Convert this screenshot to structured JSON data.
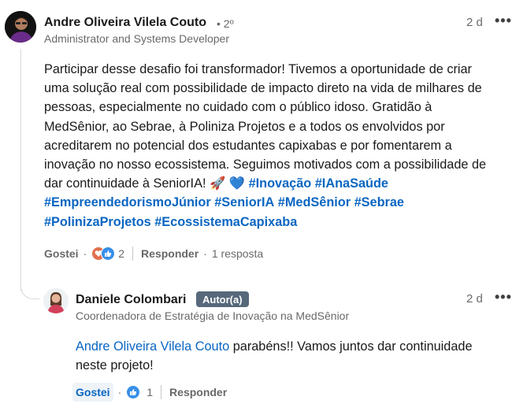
{
  "comment": {
    "author": "Andre Oliveira Vilela Couto",
    "degree": "• 2º",
    "headline": "Administrator and Systems Developer",
    "time": "2 d",
    "more": "•••",
    "text_lines": [
      "Participar desse desafio foi transformador! Tivemos a oportunidade de criar",
      "uma solução real com possibilidade de impacto direto na vida de milhares de",
      "pessoas, especialmente no cuidado com o público idoso. Gratidão à",
      "MedSênior, ao Sebrae, à Poliniza Projetos e a todos os envolvidos por",
      "acreditarem no potencial dos estudantes capixabas e por fomentarem a",
      "inovação no nosso ecossistema. Seguimos motivados com a possibilidade de"
    ],
    "last_line_text": "dar continuidade à SeniorIA! 🚀 💙 ",
    "hashtags": [
      "#Inovação",
      "#IAnaSaúde",
      "#EmpreendedorismoJúnior",
      "#SeniorIA",
      "#MedSênior",
      "#Sebrae",
      "#PolinizaProjetos",
      "#EcossistemaCapixaba"
    ],
    "actions": {
      "like": "Gostei",
      "dot": "·",
      "reaction_count": "2",
      "reply": "Responder",
      "dot2": "·",
      "replies": "1 resposta"
    },
    "reactions": [
      "love-icon",
      "like-icon"
    ]
  },
  "reply": {
    "author": "Daniele Colombari",
    "badge": "Autor(a)",
    "headline": "Coordenadora de Estratégia de Inovação na MedSênior",
    "time": "2 d",
    "more": "•••",
    "mention": "Andre Oliveira Vilela Couto",
    "text_after_mention": " parabéns!! Vamos juntos dar continuidade",
    "text_line2": "neste projeto!",
    "actions": {
      "like": "Gostei",
      "dot": "·",
      "reaction_count": "1",
      "reply": "Responder"
    },
    "reactions": [
      "like-icon"
    ]
  },
  "colors": {
    "link_blue": "#0a66c2",
    "badge_bg": "#56687a",
    "love": "#df704d",
    "like": "#378fe9"
  }
}
